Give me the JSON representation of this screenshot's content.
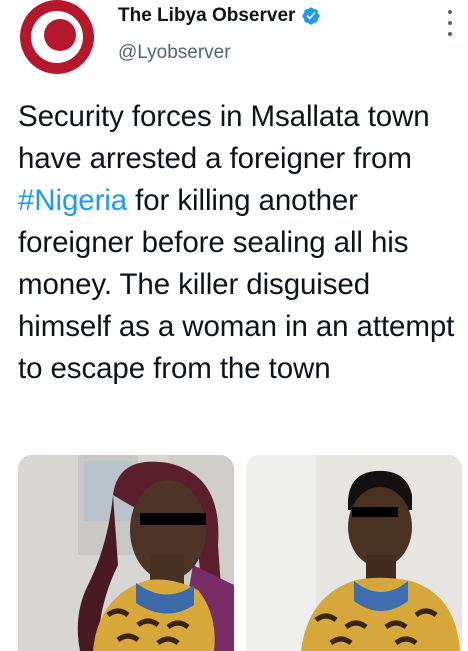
{
  "account": {
    "display_name": "The Libya Observer",
    "handle": "@Lyobserver",
    "verified": true,
    "avatar_icon": "libya-observer-logo",
    "brand_color": "#b5172c"
  },
  "tweet": {
    "text_before": "Security forces in Msallata town have arrested a foreigner from ",
    "hashtag": "#Nigeria",
    "text_after": " for killing another foreigner before sealing all his money. The killer disguised himself as a woman in an attempt to escape from the town",
    "hashtag_color": "#1d9bf0"
  },
  "media": {
    "photo_count": 2
  }
}
